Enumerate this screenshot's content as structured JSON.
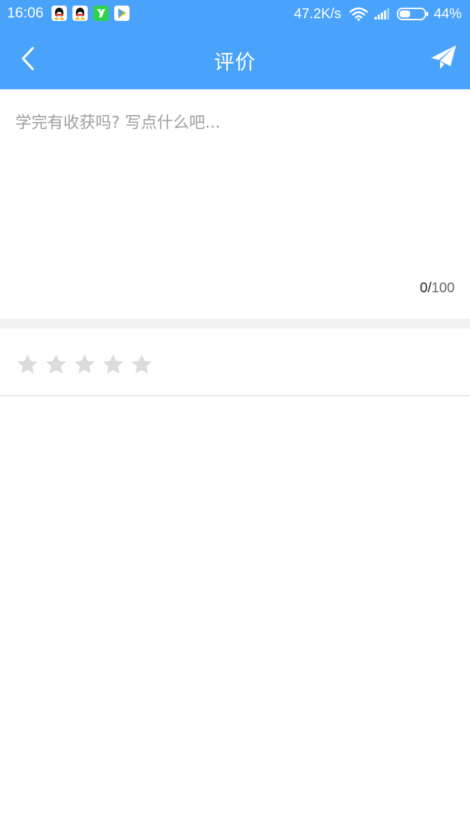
{
  "status_bar": {
    "time": "16:06",
    "app_icons": [
      "qq-icon",
      "qq-icon",
      "yuque-icon",
      "play-store-icon"
    ],
    "network_speed": "47.2K/s",
    "battery_percent": "44%",
    "battery_level": 0.44
  },
  "header": {
    "title": "评价",
    "back_icon": "chevron-left-icon",
    "send_icon": "paper-plane-icon",
    "background_color": "#4aa3fb"
  },
  "comment": {
    "value": "",
    "placeholder": "学完有收获吗? 写点什么吧...",
    "count_current": "0",
    "count_separator": "/",
    "count_max": "100"
  },
  "rating": {
    "max_stars": 5,
    "selected": 0,
    "star_color_inactive": "#dcdcdc"
  }
}
